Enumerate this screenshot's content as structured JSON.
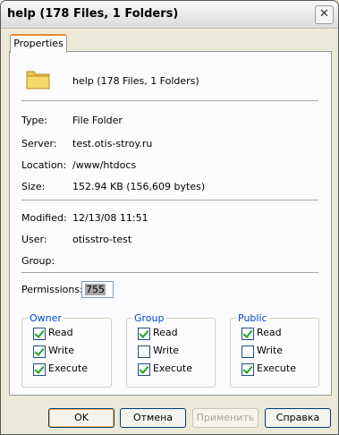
{
  "window": {
    "title": "help (178 Files, 1 Folders)"
  },
  "tabs": [
    {
      "label": "Properties"
    }
  ],
  "header": {
    "name": "help (178 Files, 1 Folders)",
    "icon": "folder-icon"
  },
  "info": {
    "type_label": "Type:",
    "type_value": "File Folder",
    "server_label": "Server:",
    "server_value": "test.otis-stroy.ru",
    "location_label": "Location:",
    "location_value": "/www/htdocs",
    "size_label": "Size:",
    "size_value": "152.94 KB (156,609 bytes)",
    "modified_label": "Modified:",
    "modified_value": "12/13/08 11:51",
    "user_label": "User:",
    "user_value": "otisstro-test",
    "group_label": "Group:",
    "group_value": ""
  },
  "permissions": {
    "label": "Permissions:",
    "value": "755"
  },
  "groups": [
    {
      "legend": "Owner",
      "items": [
        {
          "label": "Read",
          "checked": true
        },
        {
          "label": "Write",
          "checked": true
        },
        {
          "label": "Execute",
          "checked": true
        }
      ]
    },
    {
      "legend": "Group",
      "items": [
        {
          "label": "Read",
          "checked": true
        },
        {
          "label": "Write",
          "checked": false
        },
        {
          "label": "Execute",
          "checked": true
        }
      ]
    },
    {
      "legend": "Public",
      "items": [
        {
          "label": "Read",
          "checked": true
        },
        {
          "label": "Write",
          "checked": false
        },
        {
          "label": "Execute",
          "checked": true
        }
      ]
    }
  ],
  "buttons": {
    "ok": "OK",
    "cancel": "Отмена",
    "apply": "Применить",
    "help": "Справка"
  },
  "colors": {
    "accent": "#0046d5",
    "tab_highlight": "#e68b2c",
    "check": "#21a121"
  }
}
